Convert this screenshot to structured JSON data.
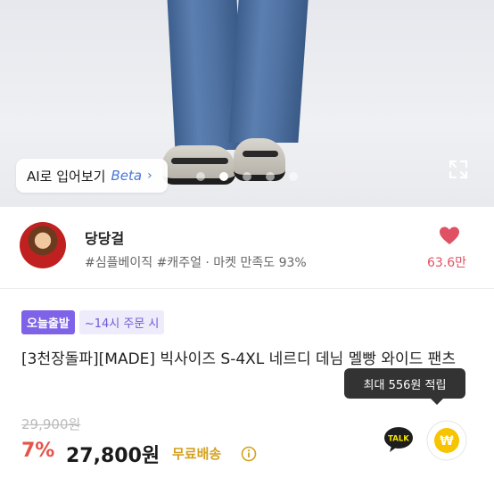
{
  "hero": {
    "ai_try_on_label": "AI로 입어보기",
    "beta_label": "Beta",
    "chevron": "›",
    "carousel_dots": 5,
    "active_dot": 1,
    "expand_icon": "expand-icon"
  },
  "seller": {
    "name": "당당걸",
    "tags": "#심플베이직 #캐주얼 · 마켓 만족도 93%",
    "like_count": "63.6만",
    "like_icon": "heart-icon"
  },
  "product": {
    "badge_today": "오늘출발",
    "badge_time": "~14시 주문 시",
    "title": "[3천장돌파][MADE] 빅사이즈 S-4XL 네르디 데님 멜빵 와이드 팬츠",
    "original_price": "29,900원",
    "discount": "7%",
    "price": "27,800원",
    "shipping": "무료배송",
    "points_tooltip": "최대 556원 적립"
  },
  "colors": {
    "accent_purple": "#7e62e8",
    "discount_red": "#e5544a",
    "heart_red": "#e05263",
    "shipping_gold": "#d4a020",
    "kakao_yellow": "#f7e600"
  }
}
